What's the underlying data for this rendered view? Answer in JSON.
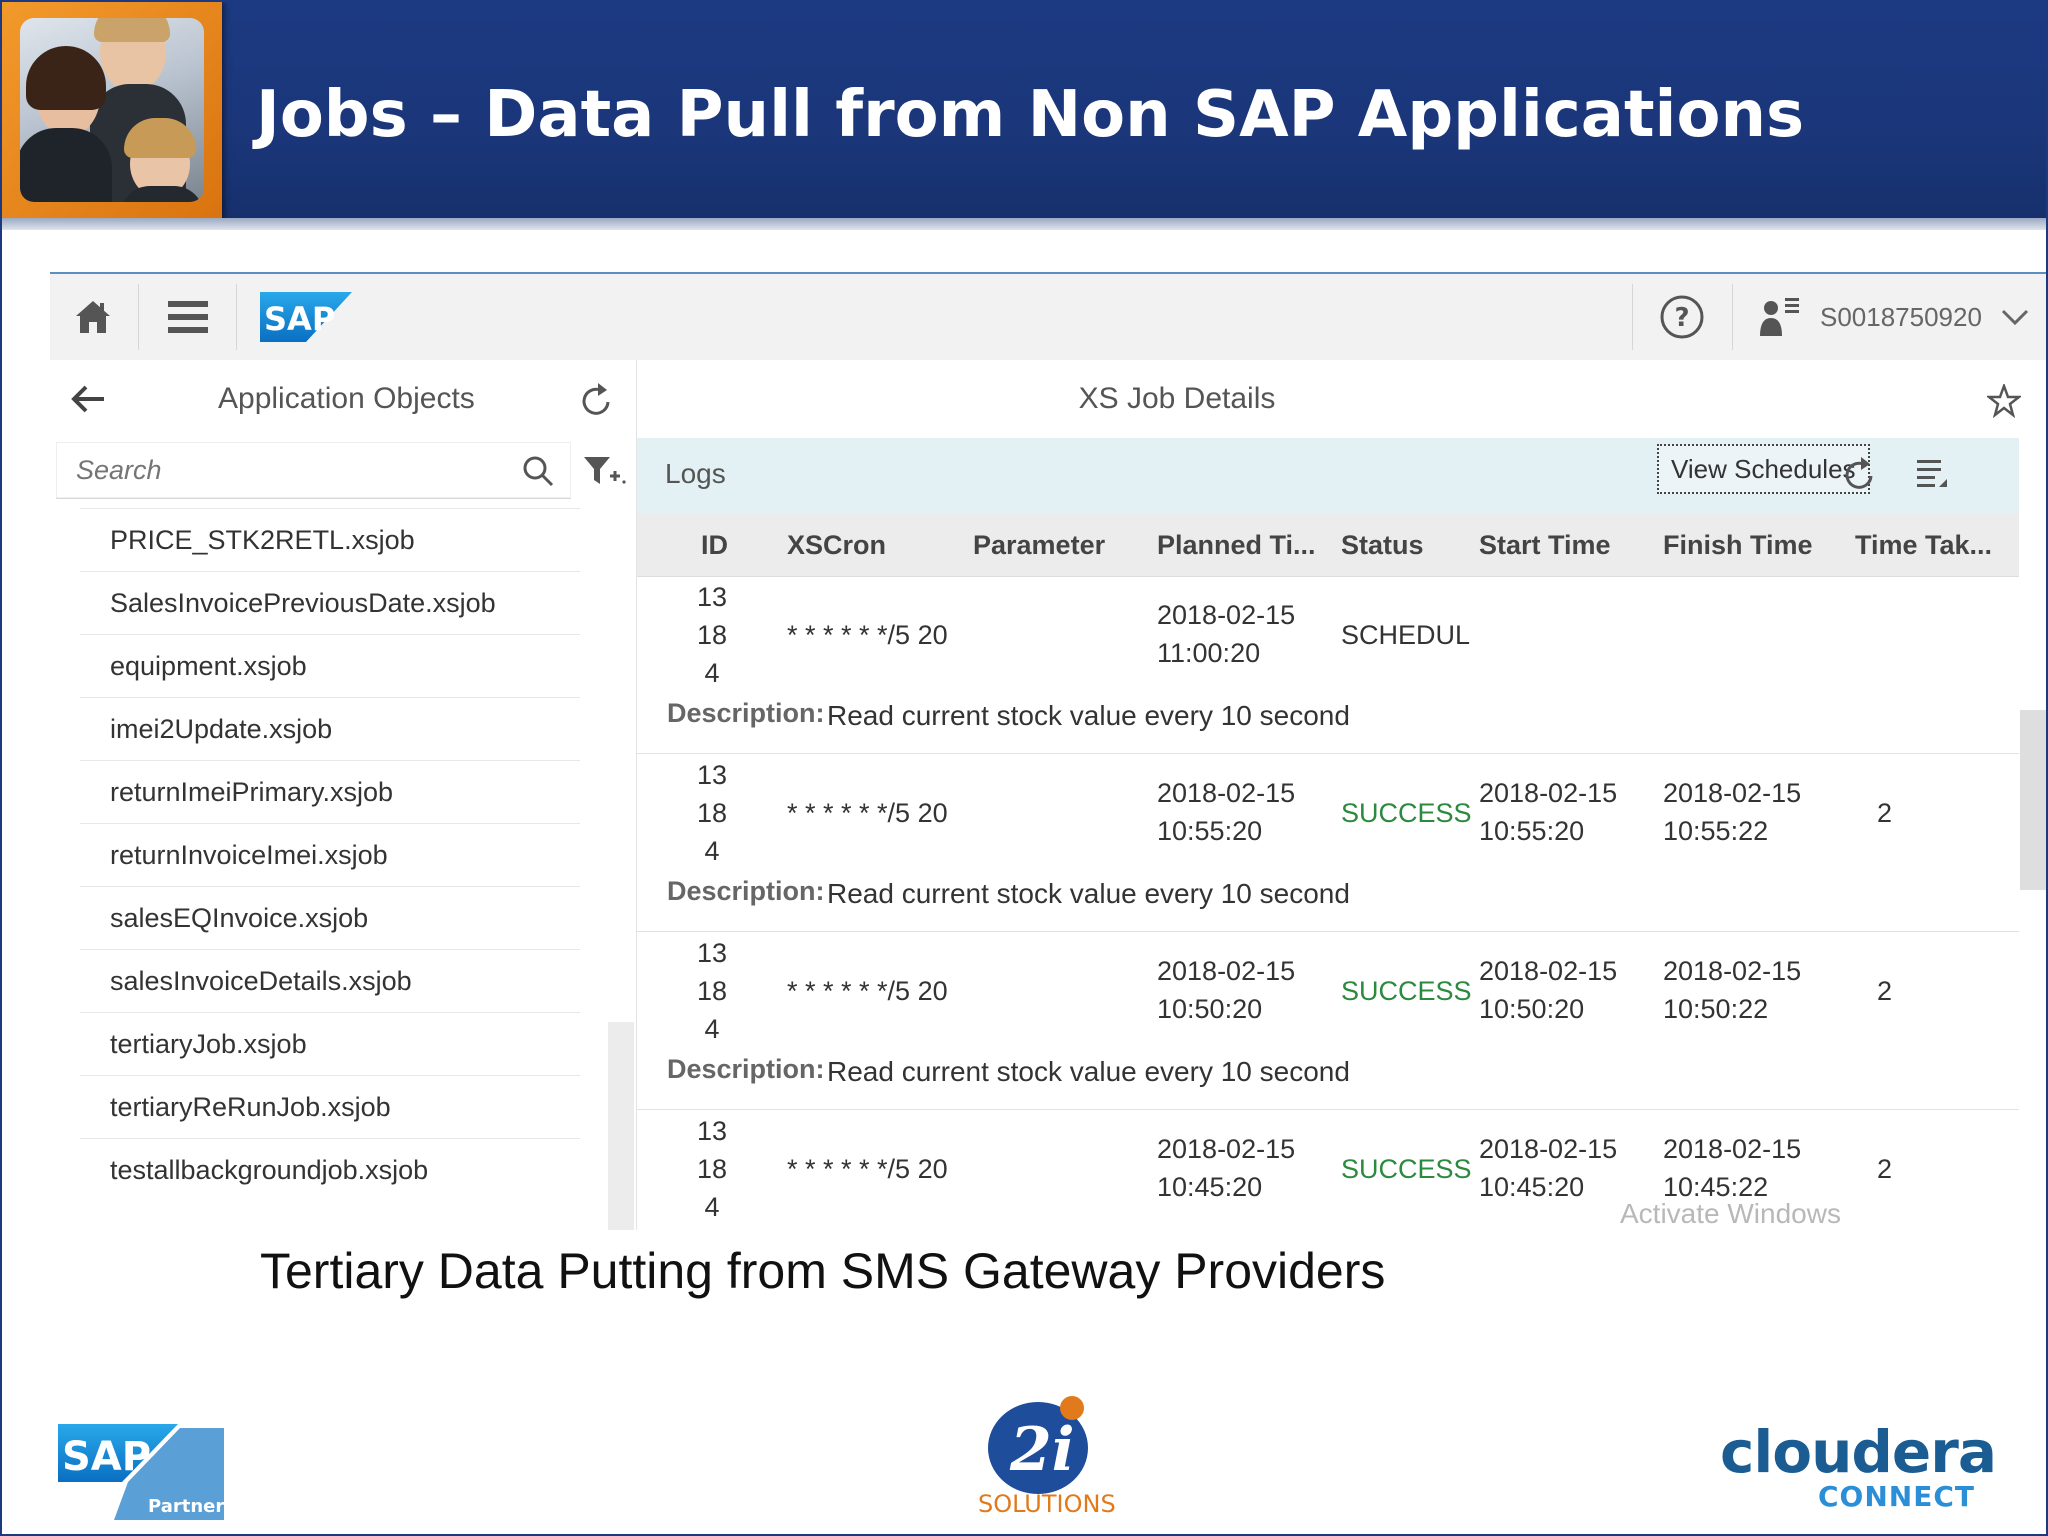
{
  "slide": {
    "title": "Jobs – Data Pull from Non SAP Applications",
    "caption": "Tertiary Data Putting from SMS Gateway Providers",
    "watermark": "Activate Windows"
  },
  "shell": {
    "logo_text": "SAP",
    "user_id": "S0018750920",
    "icons": [
      "home-icon",
      "menu-icon",
      "help-icon",
      "user-icon",
      "chevron-down-icon"
    ]
  },
  "left_panel": {
    "title": "Application Objects",
    "search_placeholder": "Search",
    "files": [
      "PRICE_STK2RETL.xsjob",
      "SalesInvoicePreviousDate.xsjob",
      "equipment.xsjob",
      "imei2Update.xsjob",
      "returnImeiPrimary.xsjob",
      "returnInvoiceImei.xsjob",
      "salesEQInvoice.xsjob",
      "salesInvoiceDetails.xsjob",
      "tertiaryJob.xsjob",
      "tertiaryReRunJob.xsjob",
      "testallbackgroundjob.xsjob"
    ]
  },
  "right_panel": {
    "title": "XS Job Details",
    "logs_label": "Logs",
    "view_schedules_label": "View Schedules",
    "columns": [
      "ID",
      "XSCron",
      "Parameter",
      "Planned Ti...",
      "Status",
      "Start Time",
      "Finish Time",
      "Time Tak..."
    ],
    "description_label": "Description:",
    "rows": [
      {
        "id": [
          "13",
          "18",
          "4"
        ],
        "xscron": "* * * * * */5 20",
        "parameter": "",
        "planned": [
          "2018-02-15",
          "11:00:20"
        ],
        "status": "SCHEDUL",
        "start": [
          "",
          ""
        ],
        "finish": [
          "",
          ""
        ],
        "time_taken": "",
        "description": "Read current stock value every 10 second"
      },
      {
        "id": [
          "13",
          "18",
          "4"
        ],
        "xscron": "* * * * * */5 20",
        "parameter": "",
        "planned": [
          "2018-02-15",
          "10:55:20"
        ],
        "status": "SUCCESS",
        "start": [
          "2018-02-15",
          "10:55:20"
        ],
        "finish": [
          "2018-02-15",
          "10:55:22"
        ],
        "time_taken": "2",
        "description": "Read current stock value every 10 second"
      },
      {
        "id": [
          "13",
          "18",
          "4"
        ],
        "xscron": "* * * * * */5 20",
        "parameter": "",
        "planned": [
          "2018-02-15",
          "10:50:20"
        ],
        "status": "SUCCESS",
        "start": [
          "2018-02-15",
          "10:50:20"
        ],
        "finish": [
          "2018-02-15",
          "10:50:22"
        ],
        "time_taken": "2",
        "description": "Read current stock value every 10 second"
      },
      {
        "id": [
          "13",
          "18",
          "4"
        ],
        "xscron": "* * * * * */5 20",
        "parameter": "",
        "planned": [
          "2018-02-15",
          "10:45:20"
        ],
        "status": "SUCCESS",
        "start": [
          "2018-02-15",
          "10:45:20"
        ],
        "finish": [
          "2018-02-15",
          "10:45:22"
        ],
        "time_taken": "2",
        "description": ""
      }
    ]
  },
  "footer": {
    "sap_logo_text": "SAP",
    "sap_partner_text": "Partner",
    "twoi_text": "2i",
    "twoi_solutions": "SOLUTIONS",
    "cloudera_text": "cloudera",
    "cloudera_connect": "CONNECT"
  },
  "colors": {
    "header_blue": "#1c3a82",
    "photo_orange": "#f39a2c",
    "logs_bar": "#e3f1f5",
    "success_green": "#2b8a3e",
    "sap_blue": "#1a7fd4"
  }
}
